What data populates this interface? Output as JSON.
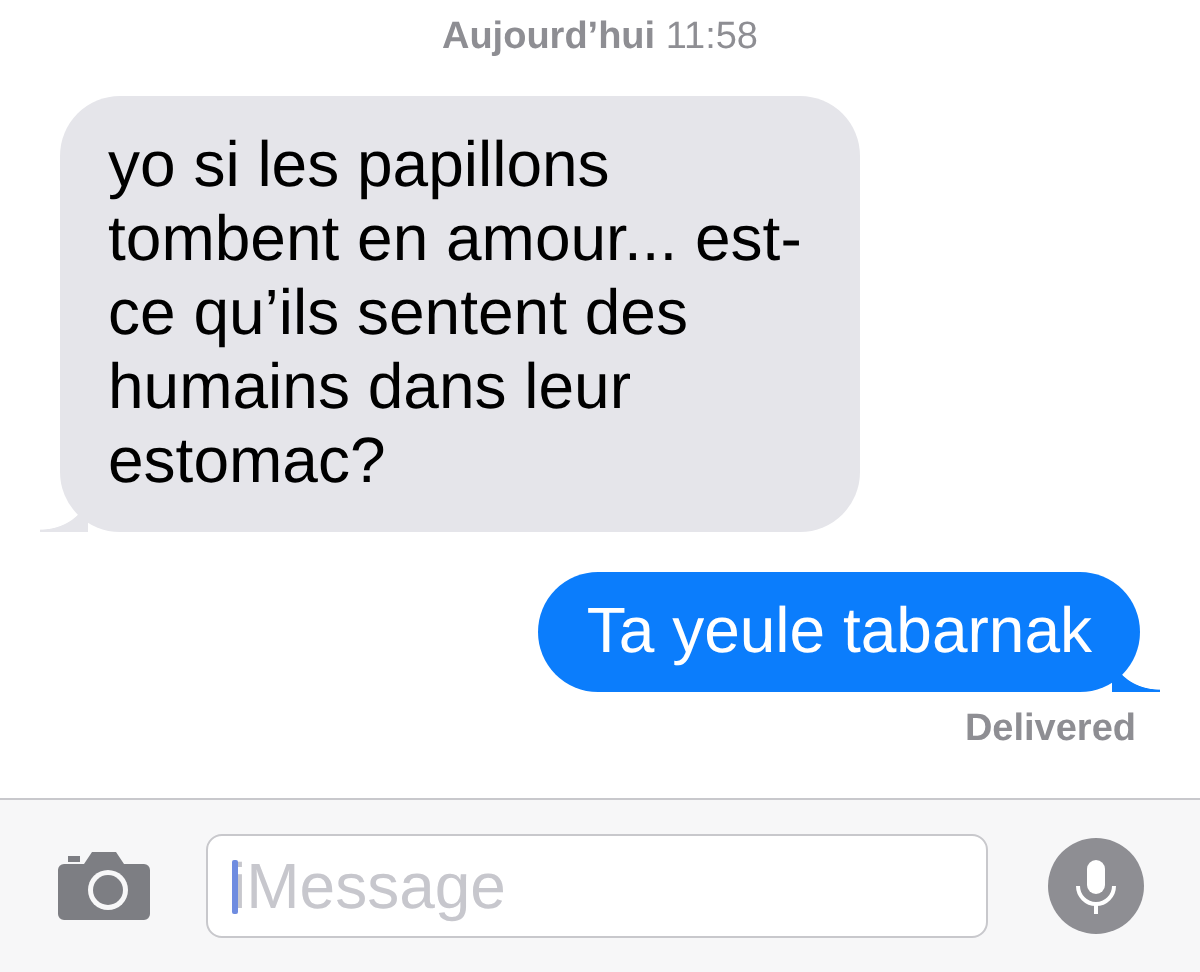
{
  "timestamp": {
    "day": "Aujourd’hui",
    "time": "11:58"
  },
  "messages": [
    {
      "kind": "received",
      "text": "yo si les papillons tombent en amour... est-ce qu’ils sentent des humains dans leur estomac?"
    },
    {
      "kind": "sent",
      "text": "Ta yeule tabarnak"
    }
  ],
  "status": "Delivered",
  "composer": {
    "placeholder": "iMessage"
  }
}
